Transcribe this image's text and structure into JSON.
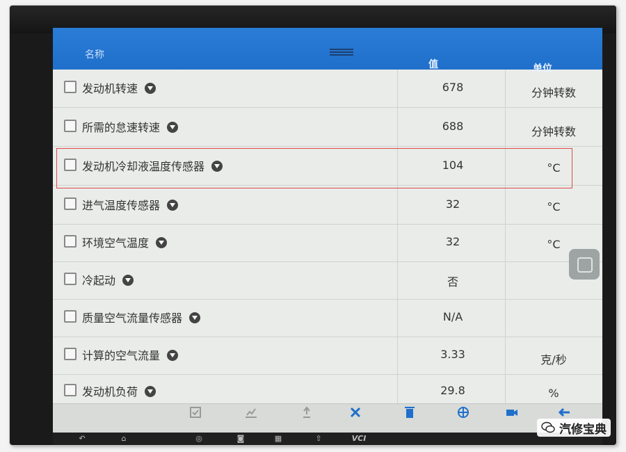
{
  "header": {
    "col_name": "名称",
    "col_value": "值",
    "col_unit": "单位"
  },
  "rows": [
    {
      "label": "发动机转速",
      "value": "678",
      "unit": "分钟转数"
    },
    {
      "label": "所需的怠速转速",
      "value": "688",
      "unit": "分钟转数"
    },
    {
      "label": "发动机冷却液温度传感器",
      "value": "104",
      "unit": "°C"
    },
    {
      "label": "进气温度传感器",
      "value": "32",
      "unit": "°C"
    },
    {
      "label": "环境空气温度",
      "value": "32",
      "unit": "°C"
    },
    {
      "label": "冷起动",
      "value": "否",
      "unit": ""
    },
    {
      "label": "质量空气流量传感器",
      "value": "N/A",
      "unit": ""
    },
    {
      "label": "计算的空气流量",
      "value": "3.33",
      "unit": "克/秒"
    },
    {
      "label": "发动机负荷",
      "value": "29.8",
      "unit": "%"
    }
  ],
  "toolbar": [
    {
      "icon": "check-icon",
      "dim": true
    },
    {
      "icon": "graph-icon",
      "dim": true
    },
    {
      "icon": "pin-icon",
      "dim": true
    },
    {
      "icon": "settings-tools-icon",
      "dim": false
    },
    {
      "icon": "clear-data-icon",
      "dim": false
    },
    {
      "icon": "freeze-icon",
      "dim": false
    },
    {
      "icon": "record-icon",
      "dim": false
    },
    {
      "icon": "back-arrow-icon",
      "dim": false
    }
  ],
  "nav": [
    "back-icon",
    "home-icon",
    "chrome-icon",
    "camera-icon",
    "apps-icon",
    "up-icon"
  ],
  "nav_text": "VCI",
  "watermark": {
    "text": "汽修宝典"
  },
  "colors": {
    "header_blue": "#1f6fcb",
    "highlight_red": "#e04848",
    "row_bg": "#e9ece9"
  }
}
